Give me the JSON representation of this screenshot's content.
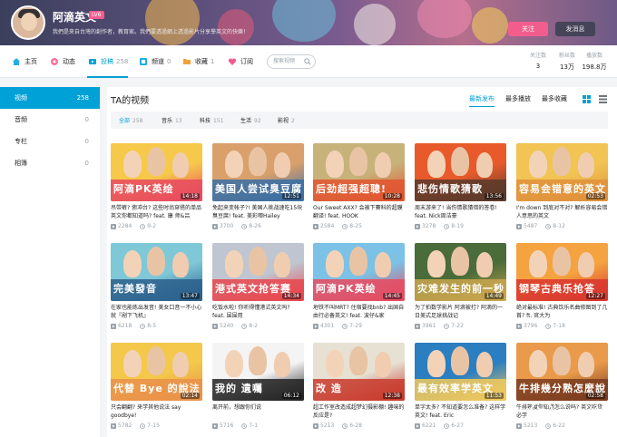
{
  "user": {
    "name": "阿滴英文",
    "level": "LV6",
    "sign": "我們是來自台灣的創作者，教育家。我們要透過網上透過影片分享學英文的快樂！"
  },
  "buttons": {
    "follow": "关注",
    "message": "发消息"
  },
  "nav": [
    {
      "label": "主页",
      "icon": "home-icon",
      "count": ""
    },
    {
      "label": "动态",
      "icon": "dynamic-icon",
      "count": ""
    },
    {
      "label": "投稿",
      "icon": "video-icon",
      "count": "258"
    },
    {
      "label": "频道",
      "icon": "channel-icon",
      "count": "0"
    },
    {
      "label": "收藏",
      "icon": "folder-icon",
      "count": "1"
    },
    {
      "label": "订阅",
      "icon": "heart-icon",
      "count": ""
    }
  ],
  "search": {
    "placeholder": "搜索视频"
  },
  "stats": [
    {
      "label": "关注数",
      "value": "3"
    },
    {
      "label": "粉丝数",
      "value": "13万"
    },
    {
      "label": "播放数",
      "value": "198.8万"
    }
  ],
  "sidebar": [
    {
      "label": "视频",
      "count": "258"
    },
    {
      "label": "音频",
      "count": "0"
    },
    {
      "label": "专栏",
      "count": "0"
    },
    {
      "label": "相簿",
      "count": "0"
    }
  ],
  "section": {
    "title": "TA的视频"
  },
  "sorts": [
    "最新发布",
    "最多播放",
    "最多收藏"
  ],
  "filters": [
    {
      "label": "全部",
      "count": "258"
    },
    {
      "label": "音乐",
      "count": "13"
    },
    {
      "label": "科技",
      "count": "151"
    },
    {
      "label": "生活",
      "count": "92"
    },
    {
      "label": "影视",
      "count": "2"
    }
  ],
  "videos": [
    {
      "title": "吊带裤? 俯冲台? 这些时尚穿搭的单品英文你都知道吗? feat. 康 师&吕",
      "caption": "阿滴PK英绘",
      "duration": "14:18",
      "plays": "2284",
      "date": "9-2",
      "colors": [
        "#f7c94a",
        "#e84a5f"
      ]
    },
    {
      "title": "免起来变帐子?! 美国人挑战速吃15块臭豆腐! feat. 美彩唧Hailey",
      "caption": "美国人尝试臭豆腐",
      "duration": "12:51",
      "plays": "3700",
      "date": "8-26",
      "colors": [
        "#d9a06b",
        "#3a6ea5"
      ]
    },
    {
      "title": "Our Sweet AXX? 会被下賽科的超膜翻译! feat. HOOK",
      "caption": "后劲超强超聰!",
      "duration": "10:28",
      "plays": "2584",
      "date": "8-25",
      "colors": [
        "#c7b27a",
        "#e2552f"
      ]
    },
    {
      "title": "周末游来了! 当伤情歌猜错的答卷! feat. Nick周洁豪",
      "caption": "悲伤情歌猜歌",
      "duration": "13:56",
      "plays": "3278",
      "date": "8-19",
      "colors": [
        "#e85a2b",
        "#5a3a2c"
      ]
    },
    {
      "title": "I'm down 到底对不对? 解析容易会错人意思的英文",
      "caption": "容易会错意的英文",
      "duration": "02:53",
      "plays": "5487",
      "date": "8-12",
      "colors": [
        "#f1c453",
        "#e0903c"
      ]
    },
    {
      "title": "在家也能练出发音! 美女口音一不小心就『剐下飞机』",
      "caption": "完美發音",
      "duration": "13:47",
      "plays": "6218",
      "date": "8-5",
      "colors": [
        "#7ec8d8",
        "#2a5f8c"
      ]
    },
    {
      "title": "吃饭水啦! 你听得懂港式英文吗? feat. 屎屎用",
      "caption": "港式英文抢答赛",
      "duration": "14:34",
      "plays": "5240",
      "date": "8-2",
      "colors": [
        "#bfc6d1",
        "#e8474d"
      ]
    },
    {
      "title": "地铁不叫MRT? 住宿要找bnb? 出国自由行必备英文! feat. 波仔&家",
      "caption": "阿滴PK英绘",
      "duration": "14:45",
      "plays": "4301",
      "date": "7-29",
      "colors": [
        "#7cc1e6",
        "#e84a5f"
      ]
    },
    {
      "title": "为了拍数学影片 阿滴被打? 阿滴的一日美式足球挑战记",
      "caption": "灾难发生的前一秒",
      "duration": "14:49",
      "plays": "3961",
      "date": "7-22",
      "colors": [
        "#4a6b3a",
        "#c9a64d"
      ]
    },
    {
      "title": "绝对最标准! 古典饮乐名曲修图到了几首? ft. 官大为",
      "caption": "钢琴古典乐抢答",
      "duration": "12:27",
      "plays": "3796",
      "date": "7-18",
      "colors": [
        "#f4a340",
        "#d9362e"
      ]
    },
    {
      "title": "只会翻翻? 来学其他说法 say goodbye!",
      "caption": "代替 Bye 的說法",
      "duration": "02:14",
      "plays": "5782",
      "date": "7-15",
      "colors": [
        "#f4c84a",
        "#e9914a"
      ]
    },
    {
      "title": "离开前，想跟你们说",
      "caption": "我的 遺囑",
      "duration": "06:12",
      "plays": "5716",
      "date": "7-1",
      "colors": [
        "#f4f4f4",
        "#222222"
      ]
    },
    {
      "title": "超工作室改造成超梦幻摄影棚! 趣味的反应是?",
      "caption": "改 造",
      "duration": "12:38",
      "plays": "5213",
      "date": "6-28",
      "colors": [
        "#e6e1d3",
        "#c83a2c"
      ]
    },
    {
      "title": "单字太多? 不知道要怎么准备? 这样学英文! feat. Eric",
      "caption": "最有效率学英文",
      "duration": "11:53",
      "plays": "6221",
      "date": "6-27",
      "colors": [
        "#2b7fc0",
        "#f2c95a"
      ]
    },
    {
      "title": "牛排熟度你知道怎么说吗? 英文吃货必学",
      "caption": "牛排幾分熟怎麼說",
      "duration": "02:58",
      "plays": "5213",
      "date": "6-22",
      "colors": [
        "#e99a4a",
        "#7a3b1e"
      ]
    }
  ],
  "watermark": "什么值得买"
}
